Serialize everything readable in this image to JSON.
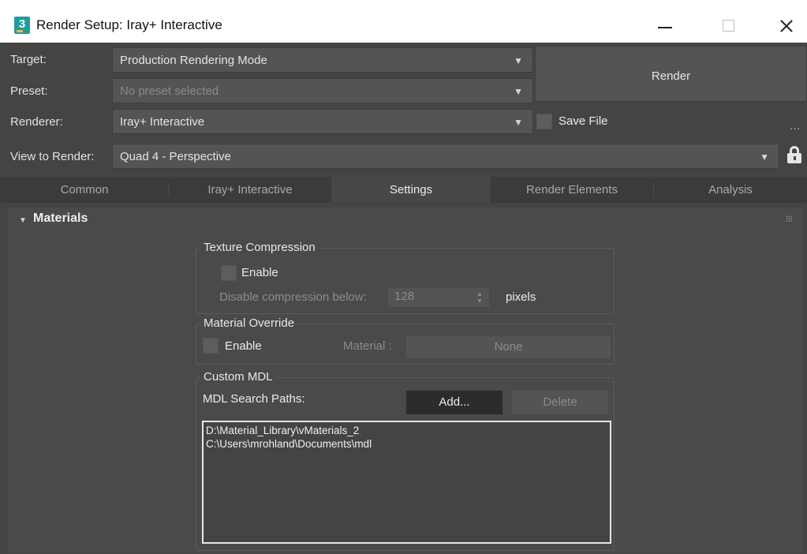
{
  "window": {
    "app_icon_label": "3",
    "title": "Render Setup: Iray+ Interactive"
  },
  "header": {
    "target_label": "Target:",
    "target_value": "Production Rendering Mode",
    "preset_label": "Preset:",
    "preset_value": "No preset selected",
    "renderer_label": "Renderer:",
    "renderer_value": "Iray+ Interactive",
    "view_label": "View to Render:",
    "view_value": "Quad 4 - Perspective",
    "render_button": "Render",
    "save_file_label": "Save File",
    "save_file_checked": false,
    "more_label": "..."
  },
  "tabs": [
    {
      "label": "Common",
      "active": false
    },
    {
      "label": "Iray+ Interactive",
      "active": false
    },
    {
      "label": "Settings",
      "active": true
    },
    {
      "label": "Render Elements",
      "active": false
    },
    {
      "label": "Analysis",
      "active": false
    }
  ],
  "materials": {
    "rollout_title": "Materials",
    "texture_compression": {
      "title": "Texture Compression",
      "enable_label": "Enable",
      "enabled": false,
      "disable_below_label": "Disable compression below:",
      "disable_below_value": "128",
      "unit_label": "pixels"
    },
    "material_override": {
      "title": "Material Override",
      "enable_label": "Enable",
      "enabled": false,
      "material_label": "Material :",
      "material_value": "None"
    },
    "custom_mdl": {
      "title": "Custom MDL",
      "search_paths_label": "MDL Search Paths:",
      "add_button": "Add...",
      "delete_button": "Delete",
      "paths": [
        "D:\\Material_Library\\vMaterials_2",
        "C:\\Users\\mrohland\\Documents\\mdl"
      ]
    }
  },
  "colors": {
    "panel_bg": "#444444",
    "field_bg": "#545454",
    "active_tab_bg": "#474747",
    "dark_button_bg": "#2c2c2c"
  }
}
